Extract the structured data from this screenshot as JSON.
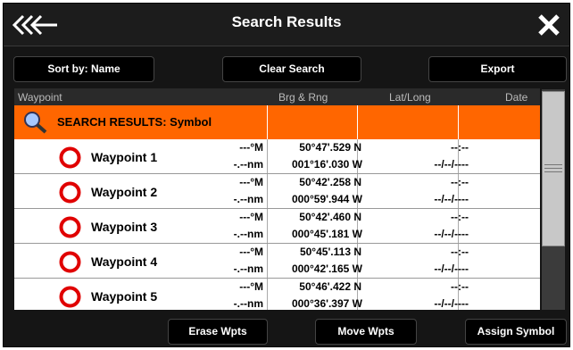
{
  "header": {
    "title": "Search Results",
    "back_icon": "triple-chevron-left-icon",
    "close_icon": "close-x-icon"
  },
  "toolbar": {
    "sort_label": "Sort by: Name",
    "clear_label": "Clear Search",
    "export_label": "Export"
  },
  "table": {
    "columns": [
      "Waypoint",
      "Brg & Rng",
      "Lat/Long",
      "Date"
    ],
    "group_label": "SEARCH RESULTS: Symbol",
    "rows": [
      {
        "name": "Waypoint 1",
        "brg": "---°M",
        "rng": "-.--nm",
        "lat": "50°47'.529 N",
        "lon": "001°16'.030 W",
        "time": "--:--",
        "date": "--/--/----"
      },
      {
        "name": "Waypoint 2",
        "brg": "---°M",
        "rng": "-.--nm",
        "lat": "50°42'.258 N",
        "lon": "000°59'.944 W",
        "time": "--:--",
        "date": "--/--/----"
      },
      {
        "name": "Waypoint 3",
        "brg": "---°M",
        "rng": "-.--nm",
        "lat": "50°42'.460 N",
        "lon": "000°45'.181 W",
        "time": "--:--",
        "date": "--/--/----"
      },
      {
        "name": "Waypoint 4",
        "brg": "---°M",
        "rng": "-.--nm",
        "lat": "50°45'.113 N",
        "lon": "000°42'.165 W",
        "time": "--:--",
        "date": "--/--/----"
      },
      {
        "name": "Waypoint 5",
        "brg": "---°M",
        "rng": "-.--nm",
        "lat": "50°46'.422 N",
        "lon": "000°36'.397 W",
        "time": "--:--",
        "date": "--/--/----"
      }
    ]
  },
  "footer": {
    "erase_label": "Erase Wpts",
    "move_label": "Move Wpts",
    "assign_label": "Assign Symbol"
  },
  "colors": {
    "accent": "#ff6600",
    "waypoint_icon": "#e00000",
    "background": "#151515"
  }
}
